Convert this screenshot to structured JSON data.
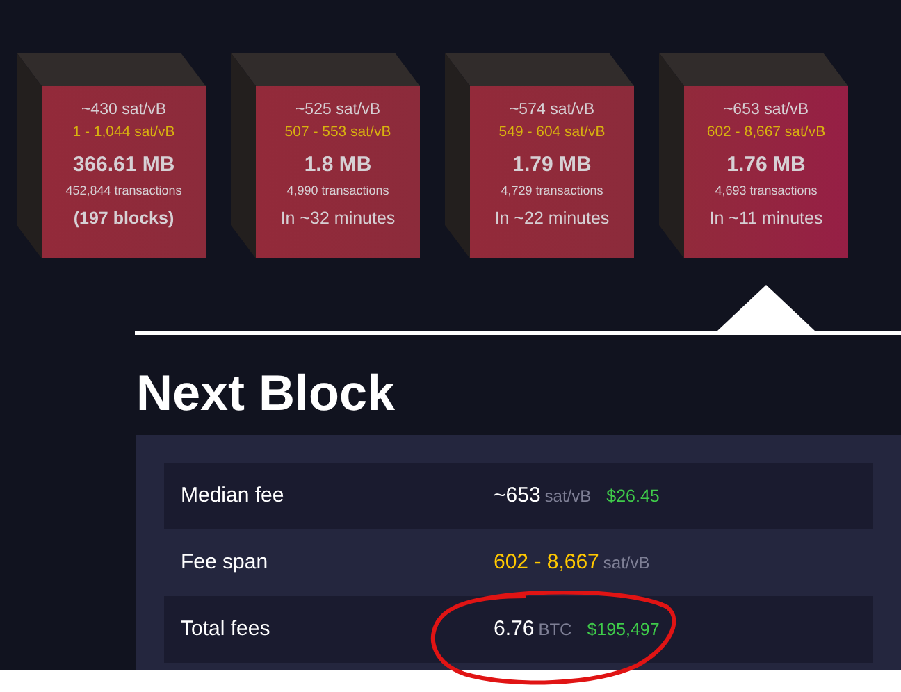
{
  "blocks": [
    {
      "median_fee": "~430 sat/vB",
      "fee_range": "1 - 1,044 sat/vB",
      "size": "366.61 MB",
      "transactions": "452,844 transactions",
      "footer": "(197 blocks)",
      "footer_bold": true,
      "selected": false
    },
    {
      "median_fee": "~525 sat/vB",
      "fee_range": "507 - 553 sat/vB",
      "size": "1.8 MB",
      "transactions": "4,990 transactions",
      "footer": "In ~32 minutes",
      "footer_bold": false,
      "selected": false
    },
    {
      "median_fee": "~574 sat/vB",
      "fee_range": "549 - 604 sat/vB",
      "size": "1.79 MB",
      "transactions": "4,729 transactions",
      "footer": "In ~22 minutes",
      "footer_bold": false,
      "selected": false
    },
    {
      "median_fee": "~653 sat/vB",
      "fee_range": "602 - 8,667 sat/vB",
      "size": "1.76 MB",
      "transactions": "4,693 transactions",
      "footer": "In ~11 minutes",
      "footer_bold": false,
      "selected": true
    }
  ],
  "title": "Next Block",
  "rows": [
    {
      "kind": "fee",
      "label": "Median fee",
      "value": "~653",
      "unit": "sat/vB",
      "fiat": "$26.45"
    },
    {
      "kind": "span",
      "label": "Fee span",
      "value": "602 - 8,667",
      "unit": "sat/vB"
    },
    {
      "kind": "fee",
      "label": "Total fees",
      "value": "6.76",
      "unit": "BTC",
      "fiat": "$195,497"
    }
  ]
}
